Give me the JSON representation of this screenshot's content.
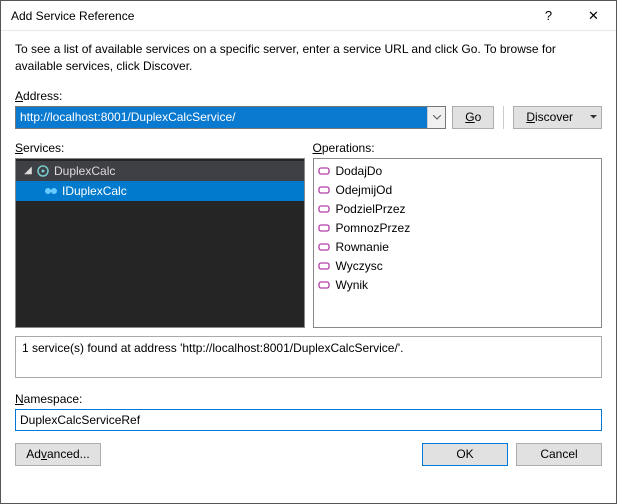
{
  "window": {
    "title": "Add Service Reference",
    "help": "?",
    "close": "✕"
  },
  "intro": "To see a list of available services on a specific server, enter a service URL and click Go. To browse for available services, click Discover.",
  "addressLabel": "Address:",
  "addressValue": "http://localhost:8001/DuplexCalcService/",
  "goLabel": "Go",
  "discoverLabel": "Discover",
  "servicesLabel": "Services:",
  "operationsLabel": "Operations:",
  "tree": {
    "root": "DuplexCalc",
    "child": "IDuplexCalc"
  },
  "operations": [
    "DodajDo",
    "OdejmijOd",
    "PodzielPrzez",
    "PomnozPrzez",
    "Rownanie",
    "Wyczysc",
    "Wynik"
  ],
  "statusText": "1 service(s) found at address 'http://localhost:8001/DuplexCalcService/'.",
  "namespaceLabel": "Namespace:",
  "namespaceValue": "DuplexCalcServiceRef",
  "advancedLabel": "Advanced...",
  "okLabel": "OK",
  "cancelLabel": "Cancel"
}
